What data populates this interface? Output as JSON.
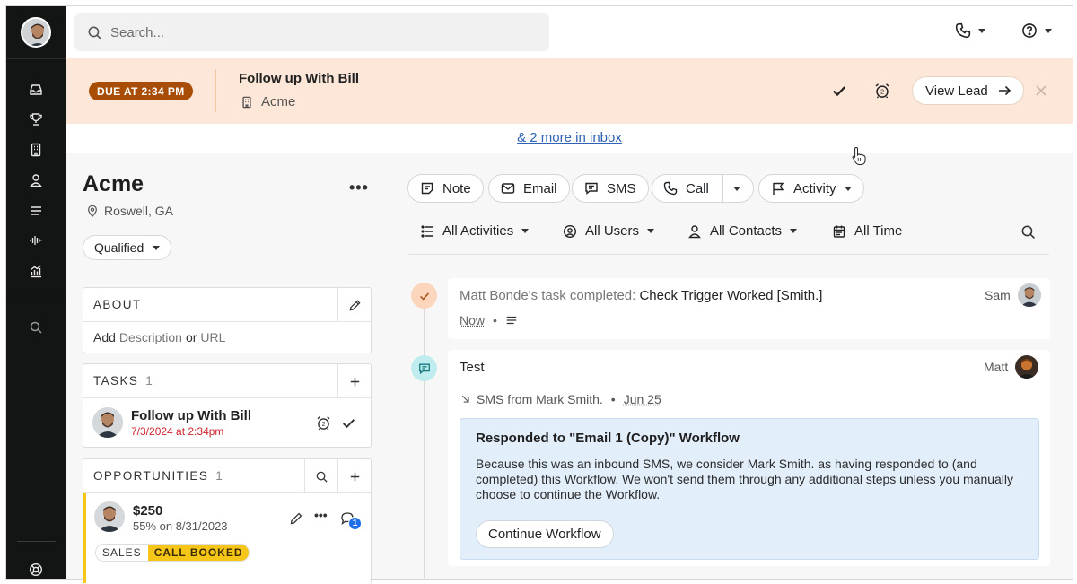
{
  "topbar": {
    "search_placeholder": "Search...",
    "phone_icon": "phone-icon",
    "help_icon": "help-icon"
  },
  "sidebar": {
    "items": [
      "inbox-icon",
      "trophy-icon",
      "building-icon",
      "person-icon",
      "list-icon",
      "waveform-icon",
      "chart-icon",
      "search-icon",
      "help-lifebuoy-icon"
    ]
  },
  "banner": {
    "due_label": "DUE AT 2:34 PM",
    "title": "Follow up With Bill",
    "company": "Acme",
    "view_lead": "View Lead",
    "more_inbox": "& 2 more in inbox"
  },
  "lead": {
    "name": "Acme",
    "location": "Roswell, GA",
    "status": "Qualified"
  },
  "about": {
    "heading": "ABOUT",
    "add": "Add",
    "description": "Description",
    "or": "or",
    "url": "URL"
  },
  "tasks": {
    "heading": "TASKS",
    "count": "1",
    "items": [
      {
        "title": "Follow up With Bill",
        "date": "7/3/2024 at 2:34pm"
      }
    ]
  },
  "opportunities": {
    "heading": "OPPORTUNITIES",
    "count": "1",
    "items": [
      {
        "amount": "$250",
        "meta": "55% on 8/31/2023",
        "pipeline": "SALES",
        "stage": "CALL BOOKED",
        "comments": "1"
      }
    ]
  },
  "actions": {
    "note": "Note",
    "email": "Email",
    "sms": "SMS",
    "call": "Call",
    "activity": "Activity"
  },
  "filters": {
    "activities": "All Activities",
    "users": "All Users",
    "contacts": "All Contacts",
    "time": "All Time"
  },
  "feed": [
    {
      "prefix": "Matt Bonde's task completed:",
      "text": "Check Trigger Worked [Smith.]",
      "time": "Now",
      "user": "Sam"
    },
    {
      "title": "Test",
      "user": "Matt",
      "sms_from": "SMS from Mark Smith.",
      "date": "Jun 25",
      "workflow_title": "Responded to \"Email 1 (Copy)\" Workflow",
      "workflow_text": "Because this was an inbound SMS, we consider Mark Smith. as having responded to (and completed) this Workflow. We won't send them through any additional steps unless you manually choose to continue the Workflow.",
      "workflow_button": "Continue Workflow"
    }
  ],
  "colors": {
    "sidebar": "#131414",
    "banner": "#fde7d8",
    "due_badge": "#a84d06",
    "link": "#2f63b5",
    "task_date": "#d1242f",
    "stage_tag": "#f5c518",
    "workflow_box": "#e3eefb",
    "badge_blue": "#1f6feb"
  }
}
